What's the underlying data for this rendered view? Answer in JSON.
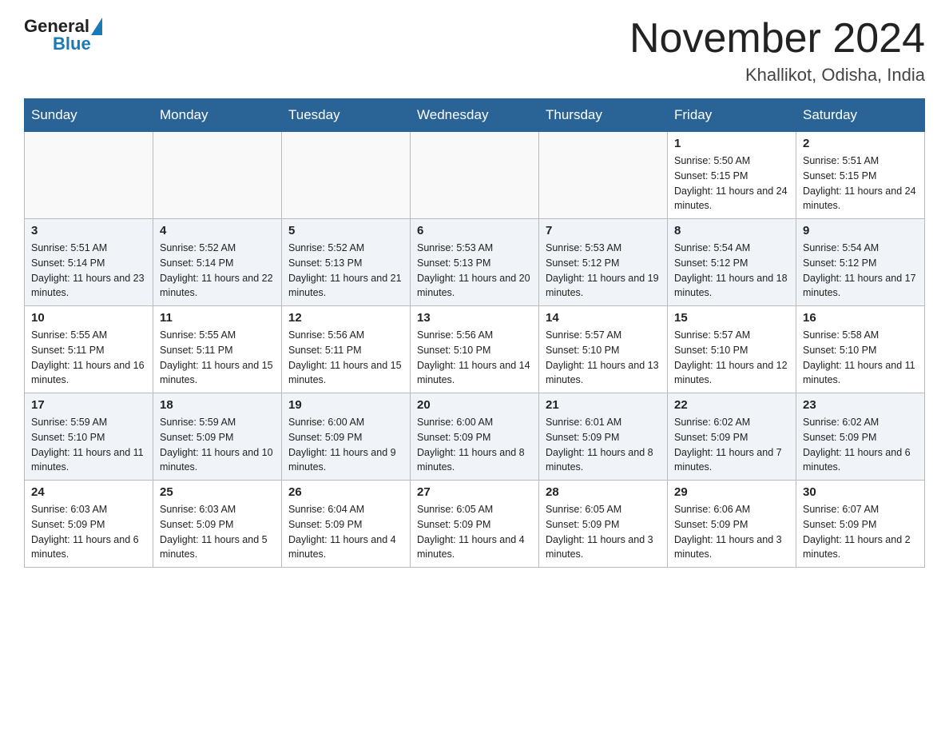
{
  "header": {
    "logo": {
      "general": "General",
      "blue": "Blue"
    },
    "title": "November 2024",
    "location": "Khallikot, Odisha, India"
  },
  "weekdays": [
    "Sunday",
    "Monday",
    "Tuesday",
    "Wednesday",
    "Thursday",
    "Friday",
    "Saturday"
  ],
  "weeks": [
    {
      "rowClass": "row-first",
      "days": [
        {
          "date": "",
          "info": ""
        },
        {
          "date": "",
          "info": ""
        },
        {
          "date": "",
          "info": ""
        },
        {
          "date": "",
          "info": ""
        },
        {
          "date": "",
          "info": ""
        },
        {
          "date": "1",
          "info": "Sunrise: 5:50 AM\nSunset: 5:15 PM\nDaylight: 11 hours and 24 minutes."
        },
        {
          "date": "2",
          "info": "Sunrise: 5:51 AM\nSunset: 5:15 PM\nDaylight: 11 hours and 24 minutes."
        }
      ]
    },
    {
      "rowClass": "row-even",
      "days": [
        {
          "date": "3",
          "info": "Sunrise: 5:51 AM\nSunset: 5:14 PM\nDaylight: 11 hours and 23 minutes."
        },
        {
          "date": "4",
          "info": "Sunrise: 5:52 AM\nSunset: 5:14 PM\nDaylight: 11 hours and 22 minutes."
        },
        {
          "date": "5",
          "info": "Sunrise: 5:52 AM\nSunset: 5:13 PM\nDaylight: 11 hours and 21 minutes."
        },
        {
          "date": "6",
          "info": "Sunrise: 5:53 AM\nSunset: 5:13 PM\nDaylight: 11 hours and 20 minutes."
        },
        {
          "date": "7",
          "info": "Sunrise: 5:53 AM\nSunset: 5:12 PM\nDaylight: 11 hours and 19 minutes."
        },
        {
          "date": "8",
          "info": "Sunrise: 5:54 AM\nSunset: 5:12 PM\nDaylight: 11 hours and 18 minutes."
        },
        {
          "date": "9",
          "info": "Sunrise: 5:54 AM\nSunset: 5:12 PM\nDaylight: 11 hours and 17 minutes."
        }
      ]
    },
    {
      "rowClass": "row-odd",
      "days": [
        {
          "date": "10",
          "info": "Sunrise: 5:55 AM\nSunset: 5:11 PM\nDaylight: 11 hours and 16 minutes."
        },
        {
          "date": "11",
          "info": "Sunrise: 5:55 AM\nSunset: 5:11 PM\nDaylight: 11 hours and 15 minutes."
        },
        {
          "date": "12",
          "info": "Sunrise: 5:56 AM\nSunset: 5:11 PM\nDaylight: 11 hours and 15 minutes."
        },
        {
          "date": "13",
          "info": "Sunrise: 5:56 AM\nSunset: 5:10 PM\nDaylight: 11 hours and 14 minutes."
        },
        {
          "date": "14",
          "info": "Sunrise: 5:57 AM\nSunset: 5:10 PM\nDaylight: 11 hours and 13 minutes."
        },
        {
          "date": "15",
          "info": "Sunrise: 5:57 AM\nSunset: 5:10 PM\nDaylight: 11 hours and 12 minutes."
        },
        {
          "date": "16",
          "info": "Sunrise: 5:58 AM\nSunset: 5:10 PM\nDaylight: 11 hours and 11 minutes."
        }
      ]
    },
    {
      "rowClass": "row-even",
      "days": [
        {
          "date": "17",
          "info": "Sunrise: 5:59 AM\nSunset: 5:10 PM\nDaylight: 11 hours and 11 minutes."
        },
        {
          "date": "18",
          "info": "Sunrise: 5:59 AM\nSunset: 5:09 PM\nDaylight: 11 hours and 10 minutes."
        },
        {
          "date": "19",
          "info": "Sunrise: 6:00 AM\nSunset: 5:09 PM\nDaylight: 11 hours and 9 minutes."
        },
        {
          "date": "20",
          "info": "Sunrise: 6:00 AM\nSunset: 5:09 PM\nDaylight: 11 hours and 8 minutes."
        },
        {
          "date": "21",
          "info": "Sunrise: 6:01 AM\nSunset: 5:09 PM\nDaylight: 11 hours and 8 minutes."
        },
        {
          "date": "22",
          "info": "Sunrise: 6:02 AM\nSunset: 5:09 PM\nDaylight: 11 hours and 7 minutes."
        },
        {
          "date": "23",
          "info": "Sunrise: 6:02 AM\nSunset: 5:09 PM\nDaylight: 11 hours and 6 minutes."
        }
      ]
    },
    {
      "rowClass": "row-odd",
      "days": [
        {
          "date": "24",
          "info": "Sunrise: 6:03 AM\nSunset: 5:09 PM\nDaylight: 11 hours and 6 minutes."
        },
        {
          "date": "25",
          "info": "Sunrise: 6:03 AM\nSunset: 5:09 PM\nDaylight: 11 hours and 5 minutes."
        },
        {
          "date": "26",
          "info": "Sunrise: 6:04 AM\nSunset: 5:09 PM\nDaylight: 11 hours and 4 minutes."
        },
        {
          "date": "27",
          "info": "Sunrise: 6:05 AM\nSunset: 5:09 PM\nDaylight: 11 hours and 4 minutes."
        },
        {
          "date": "28",
          "info": "Sunrise: 6:05 AM\nSunset: 5:09 PM\nDaylight: 11 hours and 3 minutes."
        },
        {
          "date": "29",
          "info": "Sunrise: 6:06 AM\nSunset: 5:09 PM\nDaylight: 11 hours and 3 minutes."
        },
        {
          "date": "30",
          "info": "Sunrise: 6:07 AM\nSunset: 5:09 PM\nDaylight: 11 hours and 2 minutes."
        }
      ]
    }
  ]
}
